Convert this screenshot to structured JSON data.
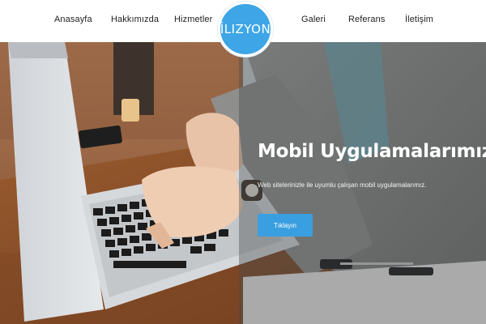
{
  "nav": {
    "items": [
      {
        "label": "Anasayfa"
      },
      {
        "label": "Hakkımızda"
      },
      {
        "label": "Hizmetler"
      },
      {
        "label": "Galeri"
      },
      {
        "label": "Referans"
      },
      {
        "label": "İletişim"
      }
    ]
  },
  "logo": {
    "text": "İLIZYON"
  },
  "hero": {
    "title": "Mobil Uygulamalarımız",
    "subtitle": "Web sitelerinizle ile uyumlu çalışan mobil uygulamalarımız.",
    "button_label": "Tıklayın"
  },
  "colors": {
    "accent": "#3ea6e6",
    "button": "#3a9fe0",
    "nav_text": "#222222"
  }
}
